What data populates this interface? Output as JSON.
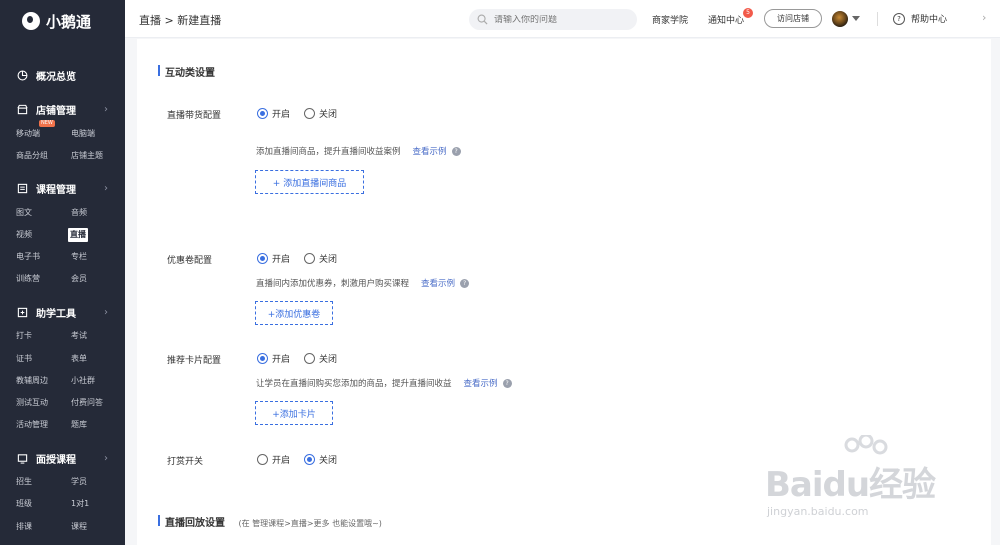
{
  "app": {
    "name": "小鹅通"
  },
  "sidebar": {
    "overview": "概况总览",
    "shop": {
      "title": "店铺管理",
      "items": [
        "移动端",
        "电脑端",
        "商品分组",
        "店铺主题"
      ],
      "new_badge": "NEW"
    },
    "course": {
      "title": "课程管理",
      "items": [
        "图文",
        "音频",
        "视频",
        "直播",
        "电子书",
        "专栏",
        "训练营",
        "会员"
      ],
      "active": "直播"
    },
    "tools": {
      "title": "助学工具",
      "items": [
        "打卡",
        "考试",
        "证书",
        "表单",
        "教辅周边",
        "小社群",
        "测试互动",
        "付费问答",
        "活动管理",
        "题库"
      ]
    },
    "offline": {
      "title": "面授课程",
      "items": [
        "招生",
        "学员",
        "班级",
        "1对1",
        "排课",
        "课程"
      ]
    }
  },
  "topbar": {
    "breadcrumb": "直播 > 新建直播",
    "search_placeholder": "请输入你的问题",
    "academy": "商家学院",
    "notifications": "通知中心",
    "notification_count": "5",
    "visit_shop": "访问店铺",
    "help": "帮助中心"
  },
  "main": {
    "interaction_title": "互动类设置",
    "options": {
      "on": "开启",
      "off": "关闭"
    },
    "goods": {
      "label": "直播带货配置",
      "value": "on",
      "desc": "添加直播间商品，提升直播间收益案例",
      "example": "查看示例",
      "button": "+ 添加直播间商品"
    },
    "coupon": {
      "label": "优惠卷配置",
      "value": "on",
      "desc": "直播间内添加优惠券，刺激用户购买课程",
      "example": "查看示例",
      "button": "+添加优惠卷"
    },
    "card": {
      "label": "推荐卡片配置",
      "value": "on",
      "desc": "让学员在直播间购买您添加的商品，提升直播间收益",
      "example": "查看示例",
      "button": "+添加卡片"
    },
    "reward": {
      "label": "打赏开关",
      "value": "off"
    },
    "playback_title": "直播回放设置",
    "playback_note": "(在 管理课程>直播>更多 也能设置哦~)"
  },
  "watermark": {
    "brand": "Baidu经验",
    "url": "jingyan.baidu.com"
  },
  "colors": {
    "sidebar_bg": "#252a38",
    "accent": "#3a6fe0",
    "badge": "#f25a4a"
  }
}
